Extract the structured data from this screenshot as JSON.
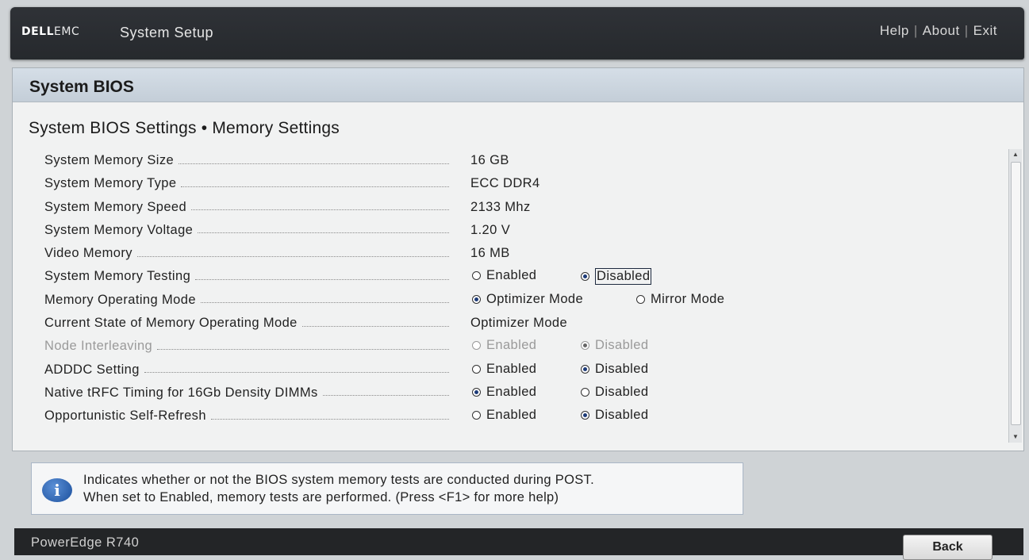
{
  "header": {
    "logo_dell": "DELL",
    "logo_emc": "EMC",
    "app_title": "System Setup",
    "links": [
      "Help",
      "About",
      "Exit"
    ]
  },
  "panel": {
    "title": "System BIOS",
    "breadcrumb": "System BIOS Settings • Memory Settings"
  },
  "settings": [
    {
      "label": "System Memory Size",
      "value": "16 GB"
    },
    {
      "label": "System Memory Type",
      "value": "ECC DDR4"
    },
    {
      "label": "System Memory Speed",
      "value": "2133 Mhz"
    },
    {
      "label": "System Memory Voltage",
      "value": "1.20 V"
    },
    {
      "label": "Video Memory",
      "value": "16 MB"
    },
    {
      "label": "System Memory Testing",
      "options": [
        "Enabled",
        "Disabled"
      ],
      "selected": "Disabled"
    },
    {
      "label": "Memory Operating Mode",
      "options": [
        "Optimizer Mode",
        "Mirror Mode"
      ],
      "selected": "Optimizer Mode"
    },
    {
      "label": "Current State of Memory Operating Mode",
      "value": "Optimizer Mode"
    },
    {
      "label": "Node Interleaving",
      "options": [
        "Enabled",
        "Disabled"
      ],
      "selected": "Disabled"
    },
    {
      "label": "ADDDC Setting",
      "options": [
        "Enabled",
        "Disabled"
      ],
      "selected": "Disabled"
    },
    {
      "label": "Native tRFC Timing for 16Gb Density DIMMs",
      "options": [
        "Enabled",
        "Disabled"
      ],
      "selected": "Enabled"
    },
    {
      "label": "Opportunistic Self-Refresh",
      "options": [
        "Enabled",
        "Disabled"
      ],
      "selected": "Disabled"
    }
  ],
  "help": {
    "line1": "Indicates whether or not the BIOS system memory tests are conducted during POST.",
    "line2": "When set to Enabled, memory tests are performed. (Press <F1> for more help)"
  },
  "footer": {
    "model": "PowerEdge R740",
    "back_label": "Back"
  },
  "icons": {
    "info": "info-icon",
    "scroll_up": "arrow-up-icon",
    "scroll_down": "arrow-down-icon"
  }
}
